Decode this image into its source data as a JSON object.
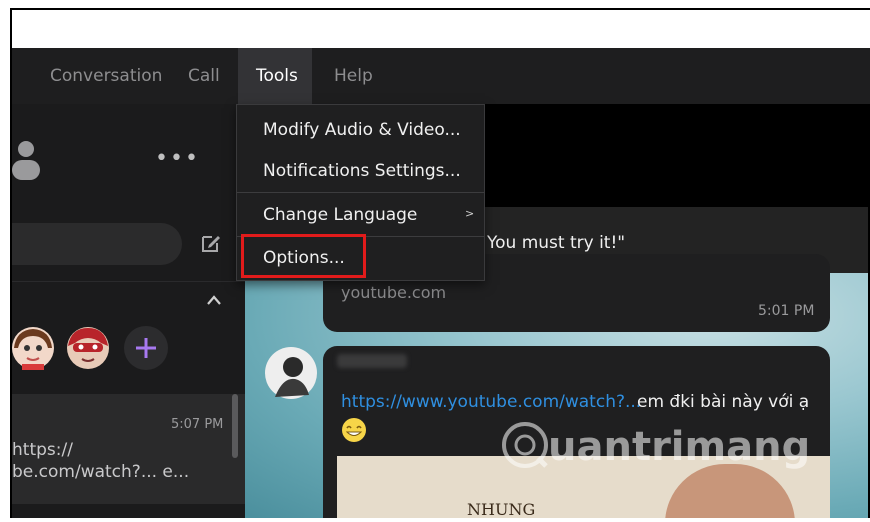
{
  "menubar": {
    "items": [
      {
        "label": "Conversation"
      },
      {
        "label": "Call"
      },
      {
        "label": "Tools"
      },
      {
        "label": "Help"
      }
    ]
  },
  "tools_menu": {
    "items": [
      {
        "label": "Modify Audio & Video..."
      },
      {
        "label": "Notifications Settings..."
      },
      {
        "label": "Change Language",
        "submenu_indicator": ">"
      },
      {
        "label": "Options..."
      }
    ],
    "highlight_color": "#e11b1b"
  },
  "sidebar": {
    "more_icon": "•••",
    "chat_item": {
      "time": "5:07 PM",
      "preview_line1": "https://",
      "preview_line2": "be.com/watch?... e..."
    }
  },
  "conversation": {
    "quote_text": "You must try it!\"",
    "message1": {
      "link_domain": "youtube.com",
      "time": "5:01 PM"
    },
    "message2": {
      "link": "https://www.youtube.com/watch?...",
      "text": "em đki bài này với ạ",
      "emoji": "smile-emoji"
    },
    "thumbnail_text": "NHUNG"
  },
  "watermark": {
    "text": "uantrimang"
  },
  "colors": {
    "accent_link": "#2f8fe0",
    "menubar_bg": "#1e1e1f",
    "active_menu_bg": "#333336"
  }
}
